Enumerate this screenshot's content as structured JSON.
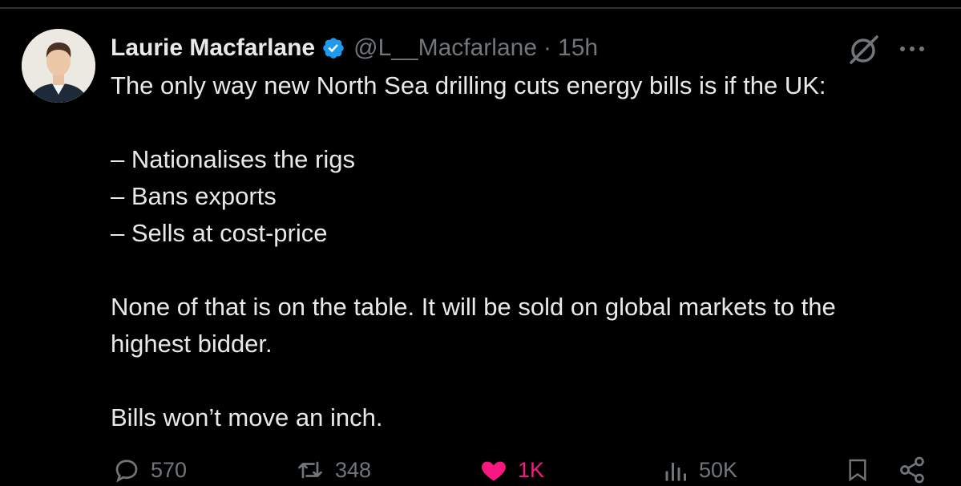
{
  "tweet": {
    "author_name": "Laurie Macfarlane",
    "author_handle": "@L__Macfarlane",
    "separator": "·",
    "time_ago": "15h",
    "verified": true,
    "body": {
      "line1": "The only way new North Sea drilling cuts energy bills is if the UK:",
      "bullet1": "– Nationalises the rigs",
      "bullet2": "– Bans exports",
      "bullet3": "– Sells at cost-price",
      "para2_line1": "None of that is on the table. It will be sold on global markets to the",
      "para2_line2": "highest bidder.",
      "closing": "Bills won’t move an inch."
    }
  },
  "actions": {
    "reply_count": "570",
    "retweet_count": "348",
    "like_count": "1K",
    "views_count": "50K"
  },
  "icons": {
    "verified": "verified-badge-icon",
    "grok": "grok-icon",
    "more": "more-icon",
    "reply": "reply-icon",
    "retweet": "retweet-icon",
    "like": "heart-icon",
    "views": "views-icon",
    "bookmark": "bookmark-icon",
    "share": "share-icon"
  },
  "colors": {
    "background": "#000000",
    "text": "#e7e9ea",
    "muted": "#71767b",
    "verified": "#1d9bf0",
    "like": "#f91880",
    "divider": "#2f3336"
  }
}
